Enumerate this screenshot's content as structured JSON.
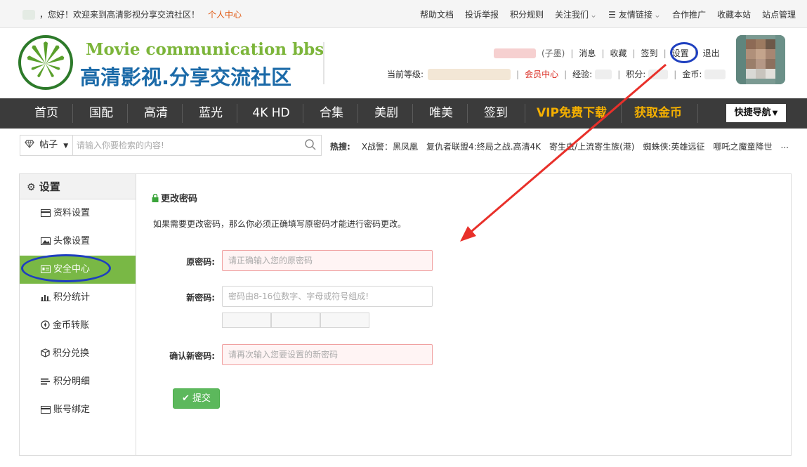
{
  "topbar": {
    "welcome": "，您好！欢迎来到高清影视分享交流社区！",
    "personal_center": "个人中心",
    "links": [
      "帮助文档",
      "投诉举报",
      "积分规则",
      "关注我们",
      "友情链接",
      "合作推广",
      "收藏本站",
      "站点管理"
    ]
  },
  "logo": {
    "title_en": "Movie communication bbs",
    "title_cn": "高清影视.分享交流社区"
  },
  "user": {
    "sub_account": "(子墨)",
    "messages": "消息",
    "favorites": "收藏",
    "checkin": "签到",
    "settings": "设置",
    "logout": "退出",
    "level_label": "当前等级:",
    "vip_center": "会员中心",
    "exp_label": "经验:",
    "points_label": "积分:",
    "coins_label": "金币:"
  },
  "nav": {
    "items": [
      "首页",
      "国配",
      "高清",
      "蓝光",
      "4K HD",
      "合集",
      "美剧",
      "唯美",
      "签到",
      "VIP免费下载",
      "获取金币"
    ],
    "quick_nav": "快捷导航"
  },
  "search": {
    "category": "帖子",
    "placeholder": "请输入你要检索的内容!",
    "hot_label": "热搜:",
    "hot_items": [
      "X战警：黑凤凰",
      "复仇者联盟4:终局之战.高清4K",
      "寄生虫/上流寄生族(港)",
      "蜘蛛侠:英雄远征",
      "哪吒之魔童降世",
      "..."
    ]
  },
  "sidebar": {
    "title": "设置",
    "items": [
      "资料设置",
      "头像设置",
      "安全中心",
      "积分统计",
      "金币转账",
      "积分兑换",
      "积分明细",
      "账号绑定"
    ],
    "active": "安全中心"
  },
  "form": {
    "title": "更改密码",
    "description": "如果需要更改密码，那么你必须正确填写原密码才能进行密码更改。",
    "old_password_label": "原密码:",
    "old_password_placeholder": "请正确输入您的原密码",
    "new_password_label": "新密码:",
    "new_password_placeholder": "密码由8-16位数字、字母或符号组成!",
    "confirm_label": "确认新密码:",
    "confirm_placeholder": "请再次输入您要设置的新密码",
    "submit": "提交"
  },
  "colors": {
    "accent_green": "#79b845",
    "nav_bg": "#3b3b3b",
    "gold": "#f5b000",
    "red": "#d9261c",
    "annotation_red": "#e8302a",
    "annotation_blue": "#1e3fbf"
  }
}
